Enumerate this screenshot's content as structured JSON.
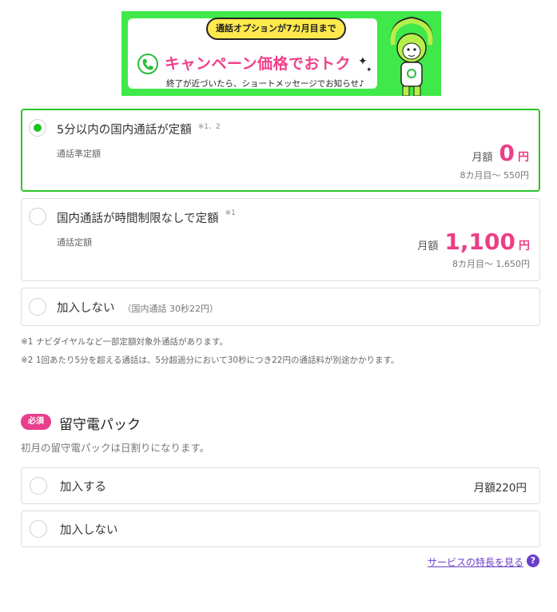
{
  "banner": {
    "pill_text": "通話オプションが7カ月目まで",
    "headline": "キャンペーン価格でおトク",
    "subtext": "終了が近づいたら、ショートメッセージでお知らせ♪",
    "phone_icon": "phone-icon",
    "mascot": "monkey-mascot"
  },
  "call_options": [
    {
      "title": "5分以内の国内通話が定額",
      "note": "※1、2",
      "subtitle": "通話準定額",
      "price_label": "月額",
      "price": "0",
      "unit": "円",
      "after_price": "8カ月目～ 550円",
      "selected": true
    },
    {
      "title": "国内通話が時間制限なしで定額",
      "note": "※1",
      "subtitle": "通話定額",
      "price_label": "月額",
      "price": "1,100",
      "unit": "円",
      "after_price": "8カ月目～ 1,650円",
      "selected": false
    },
    {
      "title": "加入しない",
      "paren": "（国内通話 30秒22円）",
      "selected": false
    }
  ],
  "footnotes": [
    "※1 ナビダイヤルなど一部定額対象外通話があります。",
    "※2 1回あたり5分を超える通話は、5分超過分において30秒につき22円の通話料が別途かかります。"
  ],
  "voicemail": {
    "badge": "必須",
    "title": "留守電パック",
    "description": "初月の留守電パックは日割りになります。",
    "options": [
      {
        "label": "加入する",
        "price": "月額220円",
        "selected": false
      },
      {
        "label": "加入しない",
        "selected": false
      }
    ]
  },
  "feature_link": "サービスの特長を見る",
  "colors": {
    "accent_green": "#2bc42b",
    "price_pink": "#ec3e87",
    "banner_green": "#3fe94a",
    "link_purple": "#6a3fc9"
  }
}
